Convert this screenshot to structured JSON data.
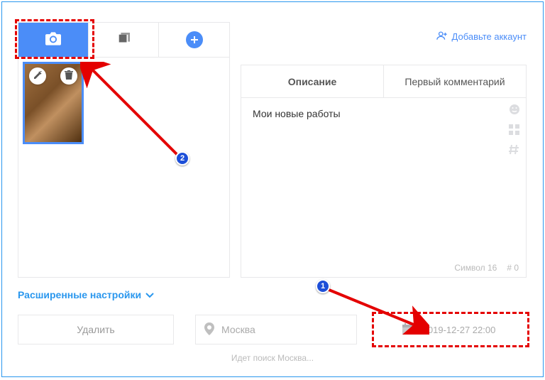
{
  "header": {
    "add_account_label": "Добавьте аккаунт"
  },
  "left_tabs": {
    "camera_label": "camera",
    "stack_label": "stack",
    "add_label": "add"
  },
  "thumbnail": {
    "edit_label": "edit",
    "delete_label": "delete"
  },
  "description": {
    "tab_desc": "Описание",
    "tab_comment": "Первый комментарий",
    "content": "Мои новые работы",
    "char_count_label": "Символ 16",
    "hash_count_label": "# 0"
  },
  "advanced_label": "Расширенные настройки",
  "delete_button_label": "Удалить",
  "location": {
    "value": "Москва"
  },
  "date": {
    "value": "2019-12-27 22:00"
  },
  "search_status": "Идет поиск Москва...",
  "badges": {
    "one": "1",
    "two": "2"
  }
}
